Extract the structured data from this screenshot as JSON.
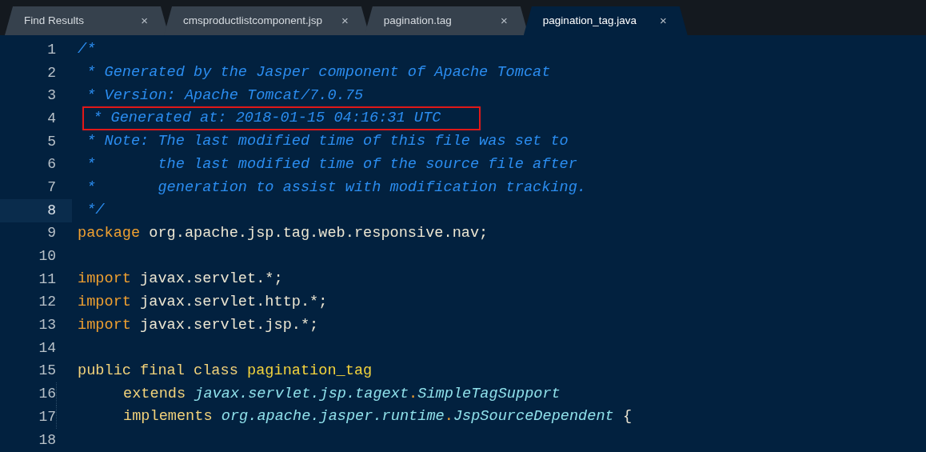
{
  "tabs": [
    {
      "label": "Find Results",
      "close": "×",
      "selected": false
    },
    {
      "label": "cmsproductlistcomponent.jsp",
      "close": "×",
      "selected": false
    },
    {
      "label": "pagination.tag",
      "close": "×",
      "selected": false
    },
    {
      "label": "pagination_tag.java",
      "close": "×",
      "selected": true
    }
  ],
  "editor": {
    "lines": [
      {
        "number": "1",
        "current": false,
        "boxed": false,
        "tokens": [
          {
            "kind": "comment",
            "text": "/*"
          }
        ]
      },
      {
        "number": "2",
        "current": false,
        "boxed": false,
        "tokens": [
          {
            "kind": "comment",
            "text": " * Generated by the Jasper component of Apache Tomcat"
          }
        ]
      },
      {
        "number": "3",
        "current": false,
        "boxed": false,
        "tokens": [
          {
            "kind": "comment",
            "text": " * Version: Apache Tomcat/7.0.75"
          }
        ]
      },
      {
        "number": "4",
        "current": false,
        "boxed": true,
        "tokens": [
          {
            "kind": "comment",
            "text": " * Generated at: 2018-01-15 04:16:31 UTC"
          }
        ]
      },
      {
        "number": "5",
        "current": false,
        "boxed": false,
        "tokens": [
          {
            "kind": "comment",
            "text": " * Note: The last modified time of this file was set to"
          }
        ]
      },
      {
        "number": "6",
        "current": false,
        "boxed": false,
        "tokens": [
          {
            "kind": "comment",
            "text": " *       the last modified time of the source file after"
          }
        ]
      },
      {
        "number": "7",
        "current": false,
        "boxed": false,
        "tokens": [
          {
            "kind": "comment",
            "text": " *       generation to assist with modification tracking."
          }
        ]
      },
      {
        "number": "8",
        "current": true,
        "boxed": false,
        "tokens": [
          {
            "kind": "comment",
            "text": " */"
          }
        ]
      },
      {
        "number": "9",
        "current": false,
        "boxed": false,
        "tokens": [
          {
            "kind": "keyword",
            "text": "package"
          },
          {
            "kind": "plain",
            "text": " org.apache.jsp.tag.web.responsive.nav;"
          }
        ]
      },
      {
        "number": "10",
        "current": false,
        "boxed": false
      },
      {
        "number": "11",
        "current": false,
        "boxed": false,
        "tokens": [
          {
            "kind": "keyword",
            "text": "import"
          },
          {
            "kind": "plain",
            "text": " javax.servlet.*;"
          }
        ]
      },
      {
        "number": "12",
        "current": false,
        "boxed": false,
        "tokens": [
          {
            "kind": "keyword",
            "text": "import"
          },
          {
            "kind": "plain",
            "text": " javax.servlet.http.*;"
          }
        ]
      },
      {
        "number": "13",
        "current": false,
        "boxed": false,
        "tokens": [
          {
            "kind": "keyword",
            "text": "import"
          },
          {
            "kind": "plain",
            "text": " javax.servlet.jsp.*;"
          }
        ]
      },
      {
        "number": "14",
        "current": false,
        "boxed": false
      },
      {
        "number": "15",
        "current": false,
        "boxed": false,
        "tokens": [
          {
            "kind": "storage",
            "text": "public final class"
          },
          {
            "kind": "classname",
            "text": " pagination_tag"
          }
        ]
      },
      {
        "number": "16",
        "current": false,
        "boxed": false,
        "indented": true,
        "tokens": [
          {
            "kind": "storage",
            "text": "extends"
          },
          {
            "kind": "type",
            "text": " javax.servlet.jsp.tagext"
          },
          {
            "kind": "dot",
            "text": "."
          },
          {
            "kind": "type",
            "text": "SimpleTagSupport"
          }
        ]
      },
      {
        "number": "17",
        "current": false,
        "boxed": false,
        "indented": true,
        "tokens": [
          {
            "kind": "storage",
            "text": "implements"
          },
          {
            "kind": "type",
            "text": " org.apache.jasper.runtime"
          },
          {
            "kind": "dot",
            "text": "."
          },
          {
            "kind": "type",
            "text": "JspSourceDependent"
          },
          {
            "kind": "plain",
            "text": " {"
          }
        ]
      },
      {
        "number": "18",
        "current": false,
        "boxed": false
      }
    ]
  }
}
